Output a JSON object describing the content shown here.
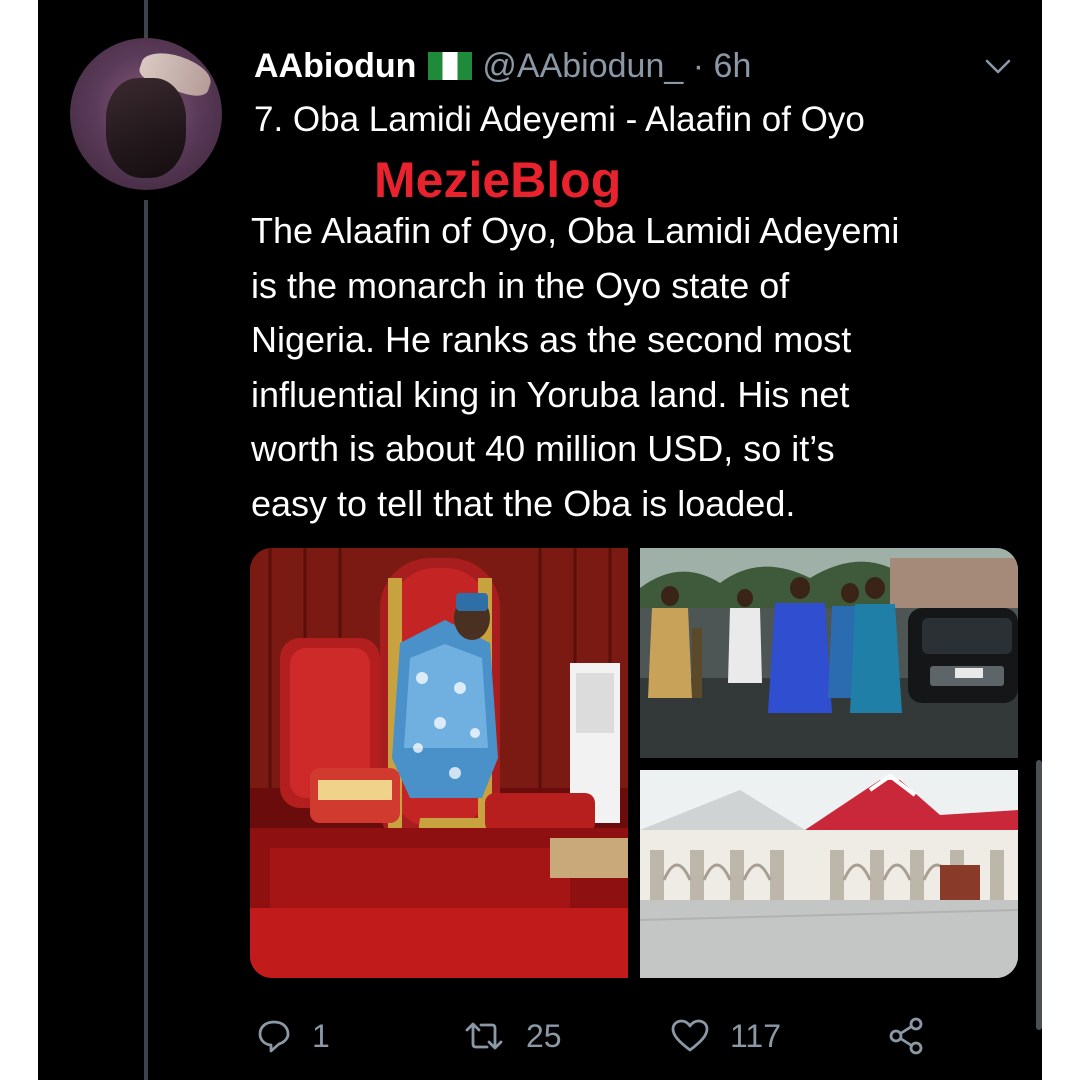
{
  "tweet": {
    "author_name": "AAbiodun",
    "handle": "@AAbiodun_",
    "separator": "·",
    "time": "6h",
    "title_line": "7. Oba Lamidi Adeyemi - Alaafin of Oyo",
    "watermark": "MezieBlog",
    "body_lines": [
      "The Alaafin of Oyo, Oba Lamidi Adeyemi",
      "is the monarch in the Oyo state of",
      "Nigeria. He ranks as the second most",
      "influential king in Yoruba land. His net",
      "worth is about 40 million USD, so it’s",
      "easy to tell that the Oba is loaded."
    ]
  },
  "media": [
    {
      "icon": "photo-oba-on-throne"
    },
    {
      "icon": "photo-oba-entourage"
    },
    {
      "icon": "photo-palace-building"
    }
  ],
  "actions": {
    "reply_count": "1",
    "retweet_count": "25",
    "like_count": "117"
  },
  "colors": {
    "background": "#000000",
    "text": "#ffffff",
    "muted": "#8b98a5",
    "watermark": "#e8232e",
    "flag_green": "#1f8a3a"
  },
  "icons": {
    "reply": "reply-icon",
    "retweet": "retweet-icon",
    "like": "heart-icon",
    "share": "share-icon",
    "menu": "chevron-down-icon",
    "flag": "nigeria-flag-icon"
  }
}
